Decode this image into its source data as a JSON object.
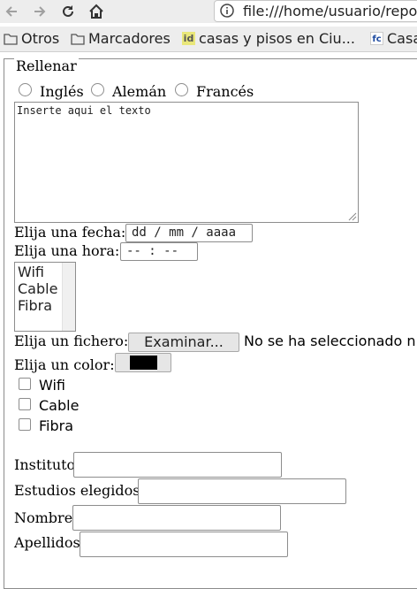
{
  "browser": {
    "url": "file:///home/usuario/repo",
    "bookmarks": [
      {
        "label": "Otros",
        "icon": "folder-icon"
      },
      {
        "label": "Marcadores",
        "icon": "folder-icon"
      },
      {
        "label": "casas y pisos en Ciu...",
        "icon": "idealista-favicon",
        "badge": "id"
      },
      {
        "label": "Casa",
        "icon": "fotocasa-favicon",
        "badge": "fc"
      }
    ]
  },
  "form": {
    "legend": "Rellenar",
    "languages": [
      "Inglés",
      "Alemán",
      "Francés"
    ],
    "textarea_value": "Inserte aqui el texto",
    "date_label": "Elija una fecha:",
    "date_placeholder": "dd / mm / aaaa",
    "time_label": "Elija una hora:",
    "time_placeholder": "-- : --",
    "connection_options": [
      "Wifi",
      "Cable",
      "Fibra"
    ],
    "file_label": "Elija un fichero:",
    "file_button": "Examinar...",
    "file_status": "No se ha seleccionado ni",
    "color_label": "Elija un color:",
    "color_value": "#000000",
    "checkboxes": [
      "Wifi",
      "Cable",
      "Fibra"
    ],
    "fields": [
      "Instituto",
      "Estudios elegidos",
      "Nombre",
      "Apellidos"
    ]
  }
}
